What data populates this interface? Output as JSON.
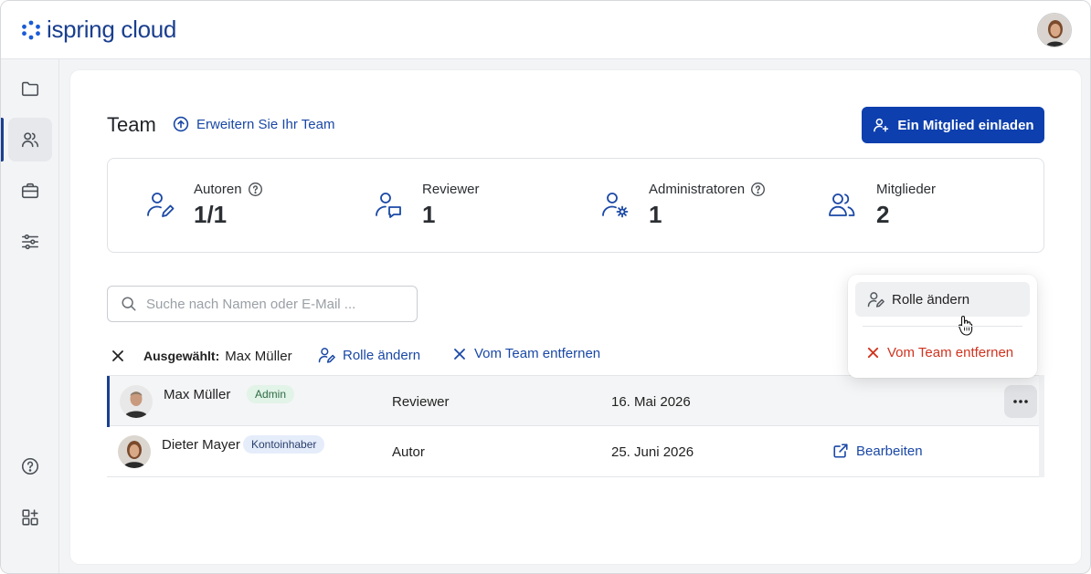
{
  "brand": {
    "name": "ispring cloud",
    "accent": "#1a3f8f"
  },
  "header": {
    "user_avatar": "user-avatar"
  },
  "sidebar": {
    "items": [
      {
        "name": "folder-icon"
      },
      {
        "name": "users-icon",
        "active": true
      },
      {
        "name": "briefcase-icon"
      },
      {
        "name": "sliders-icon"
      }
    ],
    "bottom": [
      {
        "name": "help-icon"
      },
      {
        "name": "apps-add-icon"
      }
    ]
  },
  "team": {
    "title": "Team",
    "expand_link": "Erweitern Sie Ihr Team",
    "invite_button": "Ein Mitglied einladen"
  },
  "stats": [
    {
      "label": "Autoren",
      "value": "1/1",
      "help": true,
      "icon": "author-icon"
    },
    {
      "label": "Reviewer",
      "value": "1",
      "help": false,
      "icon": "reviewer-icon"
    },
    {
      "label": "Administratoren",
      "value": "1",
      "help": true,
      "icon": "admin-icon"
    },
    {
      "label": "Mitglieder",
      "value": "2",
      "help": false,
      "icon": "members-icon"
    }
  ],
  "search": {
    "placeholder": "Suche nach Namen oder E-Mail ...",
    "value": ""
  },
  "selection": {
    "label": "Ausgewählt:",
    "name": "Max Müller",
    "change_role": "Rolle ändern",
    "remove": "Vom Team entfernen"
  },
  "members": [
    {
      "name": "Max Müller",
      "badge": "Admin",
      "role": "Reviewer",
      "date": "16. Mai 2026",
      "selected": true
    },
    {
      "name": "Dieter Mayer",
      "badge": "Kontoinhaber",
      "role": "Autor",
      "date": "25. Juni 2026",
      "action": "Bearbeiten"
    }
  ],
  "context_menu": {
    "change_role": "Rolle ändern",
    "remove": "Vom Team entfernen"
  }
}
